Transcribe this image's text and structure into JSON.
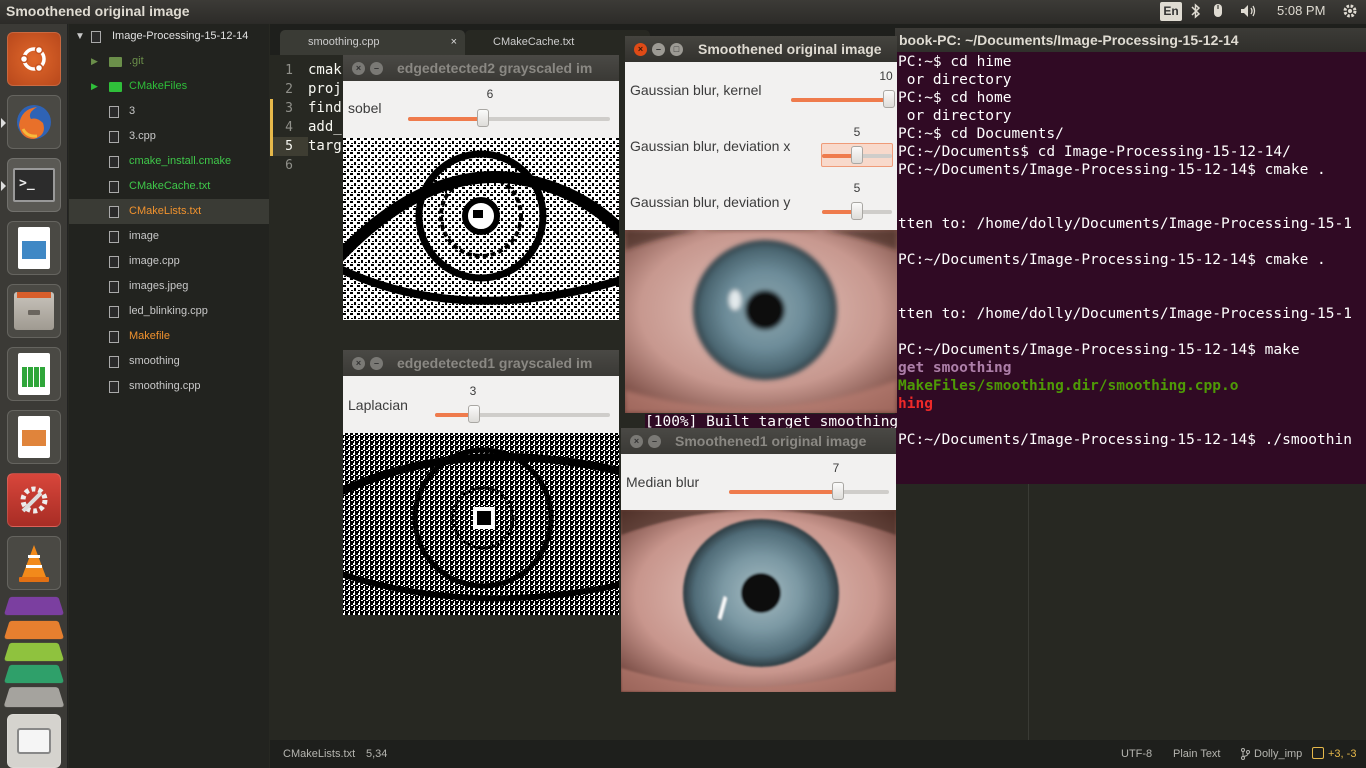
{
  "topbar": {
    "window_title": "Smoothened original image",
    "keyboard_layout": "En",
    "clock": "5:08 PM"
  },
  "launcher": {
    "items": [
      "ubuntu-dash",
      "firefox",
      "terminal",
      "libreoffice-draw",
      "file-manager",
      "libreoffice-calc",
      "libreoffice-impress",
      "system-settings",
      "vlc",
      "app-stack"
    ]
  },
  "sidebar": {
    "project": "Image-Processing-15-12-14",
    "items": [
      {
        "label": ".git",
        "type": "folder",
        "color": "#6b8f4a"
      },
      {
        "label": "CMakeFiles",
        "type": "folder",
        "color": "#2fbf3a"
      },
      {
        "label": "3",
        "type": "file",
        "color": "#c8c8c8"
      },
      {
        "label": "3.cpp",
        "type": "file",
        "color": "#c8c8c8"
      },
      {
        "label": "cmake_install.cmake",
        "type": "file",
        "color": "#3fc84a"
      },
      {
        "label": "CMakeCache.txt",
        "type": "file",
        "color": "#3fc84a"
      },
      {
        "label": "CMakeLists.txt",
        "type": "file",
        "color": "#f0922e"
      },
      {
        "label": "image",
        "type": "file",
        "color": "#c8c8c8"
      },
      {
        "label": "image.cpp",
        "type": "file",
        "color": "#c8c8c8"
      },
      {
        "label": "images.jpeg",
        "type": "file",
        "color": "#c8c8c8"
      },
      {
        "label": "led_blinking.cpp",
        "type": "file",
        "color": "#c8c8c8"
      },
      {
        "label": "Makefile",
        "type": "file",
        "color": "#f0922e"
      },
      {
        "label": "smoothing",
        "type": "file",
        "color": "#c8c8c8"
      },
      {
        "label": "smoothing.cpp",
        "type": "file",
        "color": "#c8c8c8"
      }
    ]
  },
  "editor": {
    "tabs": [
      {
        "label": "smoothing.cpp",
        "close": "×"
      },
      {
        "label": "CMakeCache.txt",
        "close": "×"
      }
    ],
    "line_numbers": [
      "1",
      "2",
      "3",
      "4",
      "5",
      "6"
    ],
    "code_lines": [
      "cmak",
      "proj",
      "find",
      "add_",
      "targ",
      ""
    ]
  },
  "statusbar": {
    "file": "CMakeLists.txt",
    "position": "5,34",
    "encoding": "UTF-8",
    "syntax": "Plain Text",
    "branch": "Dolly_imp",
    "git_changes": "+3, -3"
  },
  "terminal": {
    "title": "book-PC: ~/Documents/Image-Processing-15-12-14",
    "lines": [
      {
        "text": "PC:~$ cd hime",
        "color": "#ffffff"
      },
      {
        "text": " or directory",
        "color": "#ffffff"
      },
      {
        "text": "PC:~$ cd home",
        "color": "#ffffff"
      },
      {
        "text": " or directory",
        "color": "#ffffff"
      },
      {
        "text": "PC:~$ cd Documents/",
        "color": "#ffffff"
      },
      {
        "text": "PC:~/Documents$ cd Image-Processing-15-12-14/",
        "color": "#ffffff"
      },
      {
        "text": "PC:~/Documents/Image-Processing-15-12-14$ cmake .",
        "color": "#ffffff"
      },
      {
        "text": "",
        "color": "#ffffff"
      },
      {
        "text": "",
        "color": "#ffffff"
      },
      {
        "text": "tten to: /home/dolly/Documents/Image-Processing-15-1",
        "color": "#ffffff"
      },
      {
        "text": "",
        "color": "#ffffff"
      },
      {
        "text": "PC:~/Documents/Image-Processing-15-12-14$ cmake .",
        "color": "#ffffff"
      },
      {
        "text": "",
        "color": "#ffffff"
      },
      {
        "text": "",
        "color": "#ffffff"
      },
      {
        "text": "tten to: /home/dolly/Documents/Image-Processing-15-1",
        "color": "#ffffff"
      },
      {
        "text": "",
        "color": "#ffffff"
      },
      {
        "text": "PC:~/Documents/Image-Processing-15-12-14$ make",
        "color": "#ffffff"
      },
      {
        "text": "get smoothing",
        "color": "#ad7fa8"
      },
      {
        "text": "MakeFiles/smoothing.dir/smoothing.cpp.o",
        "color": "#4e9a06"
      },
      {
        "text": "hing",
        "color": "#ef2929"
      },
      {
        "text": "",
        "color": "#ffffff"
      },
      {
        "text": "PC:~/Documents/Image-Processing-15-12-14$ ./smoothin",
        "color": "#ffffff"
      }
    ],
    "overflow_line": "[100%] Built target smoothing"
  },
  "windows": {
    "edge2": {
      "title": "edgedetected2 grayscaled im",
      "trackbar_label": "sobel",
      "trackbar_value": "6",
      "fraction": 0.37
    },
    "edge1": {
      "title": "edgedetected1 grayscaled im",
      "trackbar_label": "Laplacian",
      "trackbar_value": "3",
      "fraction": 0.22
    },
    "smooth": {
      "title": "Smoothened original image",
      "trackbars": [
        {
          "label": "Gaussian blur, kernel",
          "value": "10",
          "fraction": 0.98
        },
        {
          "label": "Gaussian blur, deviation x",
          "value": "5",
          "fraction": 0.5
        },
        {
          "label": "Gaussian blur, deviation y",
          "value": "5",
          "fraction": 0.5
        }
      ]
    },
    "smooth1": {
      "title": "Smoothened1 original image",
      "trackbar_label": "Median blur",
      "trackbar_value": "7",
      "fraction": 0.68
    }
  },
  "colors": {
    "terminal_bg": "#300a24",
    "trackbar_fill": "#ef7b4c",
    "close_button": "#df4a16",
    "editor_bg": "#272822"
  }
}
